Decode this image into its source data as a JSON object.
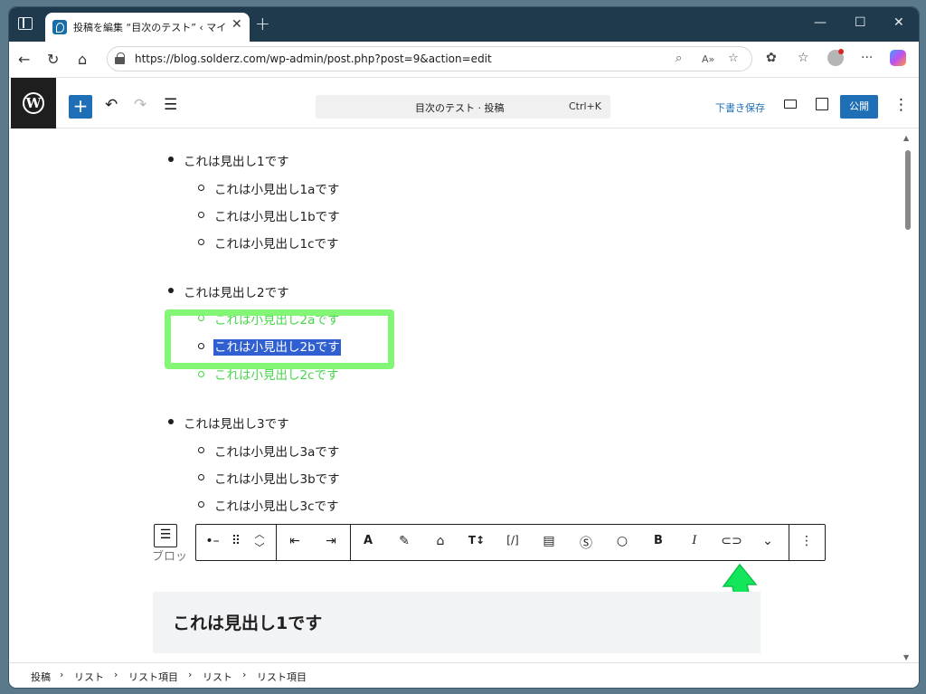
{
  "browser": {
    "tab_title": "投稿を編集 “目次のテスト” ‹ マイブロ",
    "url": "https://blog.solderz.com/wp-admin/post.php?post=9&action=edit"
  },
  "wp": {
    "doc_title": "目次のテスト · 投稿",
    "shortcut": "Ctrl+K",
    "save_draft": "下書き保存",
    "publish": "公開"
  },
  "list": [
    {
      "heading": "これは見出し1です",
      "subs": [
        "これは小見出し1aです",
        "これは小見出し1bです",
        "これは小見出し1cです"
      ]
    },
    {
      "heading": "これは見出し2です",
      "subs": [
        "これは小見出し2aです",
        "これは小見出し2bです",
        "これは小見出し2cです"
      ]
    },
    {
      "heading": "これは見出し3です",
      "subs": [
        "これは小見出し3aです",
        "これは小見出し3bです",
        "これは小見出し3cです"
      ]
    }
  ],
  "block_label": "ブロッ",
  "heading_block": "これは見出し1です",
  "breadcrumb": [
    "投稿",
    "リスト",
    "リスト項目",
    "リスト",
    "リスト項目"
  ],
  "colors": {
    "accent": "#1e6fb5",
    "highlight_green": "#7cf56e",
    "selection": "#2f5fd0"
  }
}
